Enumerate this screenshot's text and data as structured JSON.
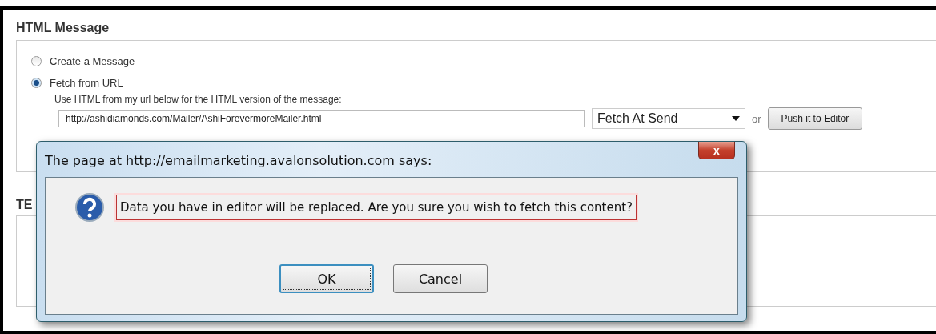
{
  "section": {
    "title": "HTML Message",
    "options": [
      {
        "label": "Create a Message",
        "selected": false
      },
      {
        "label": "Fetch from URL",
        "selected": true
      }
    ],
    "hint": "Use HTML from my url below for the HTML version of the message:",
    "url": "http://ashidiamonds.com/Mailer/AshiForevermoreMailer.html",
    "fetch_mode": "Fetch At Send",
    "or_label": "or",
    "push_button": "Push it to Editor"
  },
  "next_section": {
    "title": "TE"
  },
  "dialog": {
    "title": "The page at http://emailmarketing.avalonsolution.com says:",
    "close": "x",
    "message": "Data you have in editor will be replaced. Are you sure you wish to fetch this content?",
    "buttons": [
      {
        "label": "OK",
        "focused": true
      },
      {
        "label": "Cancel",
        "focused": false
      }
    ]
  }
}
